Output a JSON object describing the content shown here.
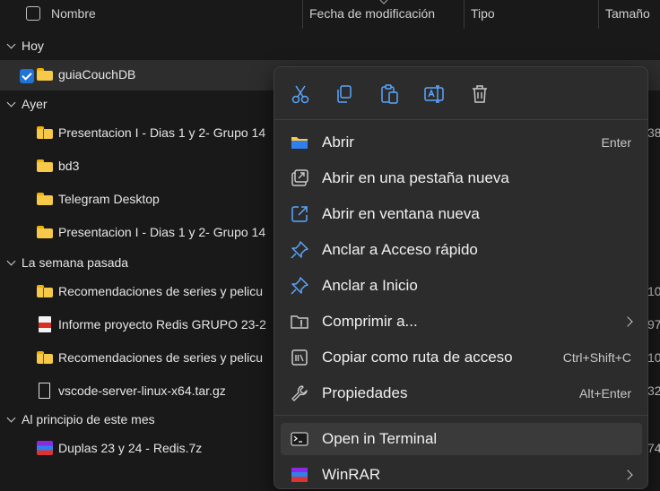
{
  "header": {
    "name": "Nombre",
    "modified": "Fecha de modificación",
    "type": "Tipo",
    "size": "Tamaño"
  },
  "groups": {
    "today": "Hoy",
    "yesterday": "Ayer",
    "last_week": "La semana pasada",
    "this_month": "Al principio de este mes"
  },
  "files": {
    "f1": {
      "name": "guiaCouchDB",
      "icon": "folder-icon"
    },
    "f2": {
      "name": "Presentacion I - Dias 1 y 2- Grupo 14",
      "size": "38",
      "icon": "zip-folder-icon"
    },
    "f3": {
      "name": "bd3",
      "icon": "folder-icon"
    },
    "f4": {
      "name": "Telegram Desktop",
      "icon": "folder-icon"
    },
    "f5": {
      "name": "Presentacion I - Dias 1 y 2- Grupo 14",
      "size": "",
      "icon": "folder-icon"
    },
    "f6": {
      "name": "Recomendaciones de series y pelicu",
      "size": "10",
      "icon": "zip-folder-icon"
    },
    "f7": {
      "name": "Informe proyecto Redis GRUPO 23-2",
      "size": "97",
      "icon": "pdf-icon"
    },
    "f8": {
      "name": "Recomendaciones de series y pelicu",
      "size": "10",
      "icon": "zip-folder-icon"
    },
    "f9": {
      "name": "vscode-server-linux-x64.tar.gz",
      "size": "32",
      "icon": "file-icon"
    },
    "f10": {
      "name": "Duplas 23 y 24 - Redis.7z",
      "size": "74",
      "icon": "winrar-icon"
    }
  },
  "menu": {
    "toolbar": [
      "cut-icon",
      "copy-icon",
      "paste-icon",
      "rename-icon",
      "delete-icon"
    ],
    "items": {
      "open": {
        "label": "Abrir",
        "shortcut": "Enter"
      },
      "new_tab": {
        "label": "Abrir en una pestaña nueva"
      },
      "new_window": {
        "label": "Abrir en ventana nueva"
      },
      "pin_quick": {
        "label": "Anclar a Acceso rápido"
      },
      "pin_start": {
        "label": "Anclar a Inicio"
      },
      "compress": {
        "label": "Comprimir a..."
      },
      "copy_path": {
        "label": "Copiar como ruta de acceso",
        "shortcut": "Ctrl+Shift+C"
      },
      "properties": {
        "label": "Propiedades",
        "shortcut": "Alt+Enter"
      },
      "terminal": {
        "label": "Open in Terminal"
      },
      "winrar": {
        "label": "WinRAR"
      }
    }
  },
  "colors": {
    "background": "#191919",
    "menu_bg": "#2c2c2c",
    "accent": "#1f74d4",
    "icon_blue": "#5aa6ff"
  }
}
